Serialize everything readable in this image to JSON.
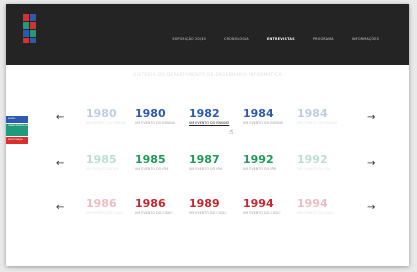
{
  "logo": {
    "colors": [
      "#d9302f",
      "#2a5bb0",
      "#1f9a7a",
      "#d9302f"
    ]
  },
  "nav": [
    "EXPOSIÇÃO 20/30",
    "CRONOLOGIA",
    "ENTREVISTAS",
    "PROGRAMA",
    "INFORMAÇÕES"
  ],
  "nav_active": "ENTREVISTAS",
  "subtitle": "HISTÓRIA DO DEPARTAMENTO DE ENGENHARIA INFORMÁTICA",
  "side": [
    "ENSINO",
    "TRANSFERÊNCIA DE TECNOLOGIA",
    "INVESTIGAÇÃO"
  ],
  "arrows": {
    "left": "←",
    "right": "→"
  },
  "rows": [
    {
      "color": "#2a5bb0",
      "events": [
        {
          "year": "1980",
          "label": "UM EVENTO DO ENSINO"
        },
        {
          "year": "1980",
          "label": "UM EVENTO DO ENSINO"
        },
        {
          "year": "1982",
          "label": "UM EVENTO DO ENSINO"
        },
        {
          "year": "1984",
          "label": "UM EVENTO DO ENSINO"
        },
        {
          "year": "1984",
          "label": "UM EVENTO DO ENSINO"
        }
      ]
    },
    {
      "color": "#1f9a5a",
      "events": [
        {
          "year": "1985",
          "label": "UM EVENTO DO IPN"
        },
        {
          "year": "1985",
          "label": "UM EVENTO DO IPN"
        },
        {
          "year": "1987",
          "label": "UM EVENTO DO IPN"
        },
        {
          "year": "1992",
          "label": "UM EVENTO DO IPN"
        },
        {
          "year": "1992",
          "label": "UM EVENTO DO IPN"
        }
      ]
    },
    {
      "color": "#c8262f",
      "events": [
        {
          "year": "1986",
          "label": "UM EVENTO DO CISUC"
        },
        {
          "year": "1986",
          "label": "UM EVENTO DO CISUC"
        },
        {
          "year": "1989",
          "label": "UM EVENTO DO CISUC"
        },
        {
          "year": "1994",
          "label": "UM EVENTO DO CISUC"
        },
        {
          "year": "1994",
          "label": "UM EVENTO DO CISUC"
        }
      ]
    }
  ]
}
